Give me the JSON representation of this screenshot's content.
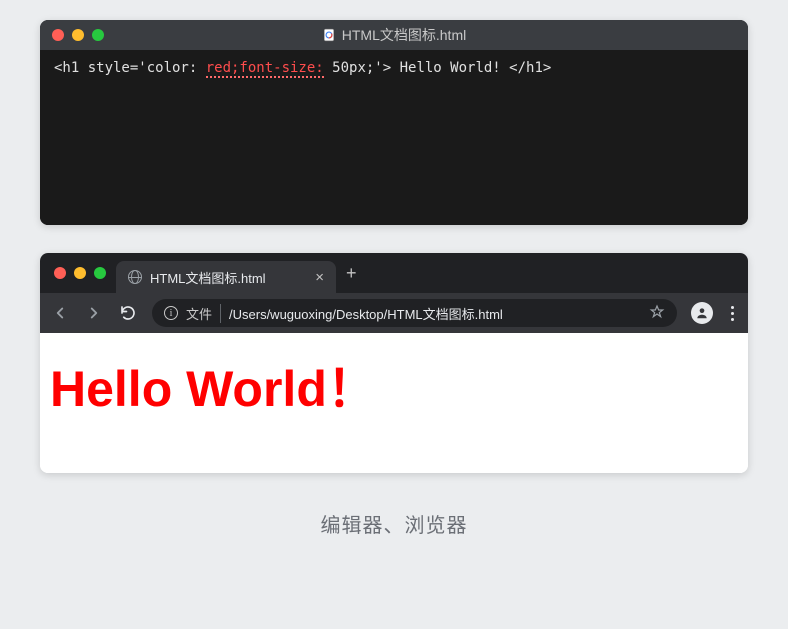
{
  "editor": {
    "title": "HTML文档图标.html",
    "code": {
      "open_tag": "<h1 style='color: ",
      "red_part": "red;font-size:",
      "rest": " 50px;'> Hello World! </h1>"
    }
  },
  "browser": {
    "tab": {
      "title": "HTML文档图标.html"
    },
    "address": {
      "label": "文件",
      "path": "/Users/wuguoxing/Desktop/HTML文档图标.html"
    },
    "viewport": {
      "heading": "Hello World！"
    }
  },
  "caption": "编辑器、浏览器"
}
